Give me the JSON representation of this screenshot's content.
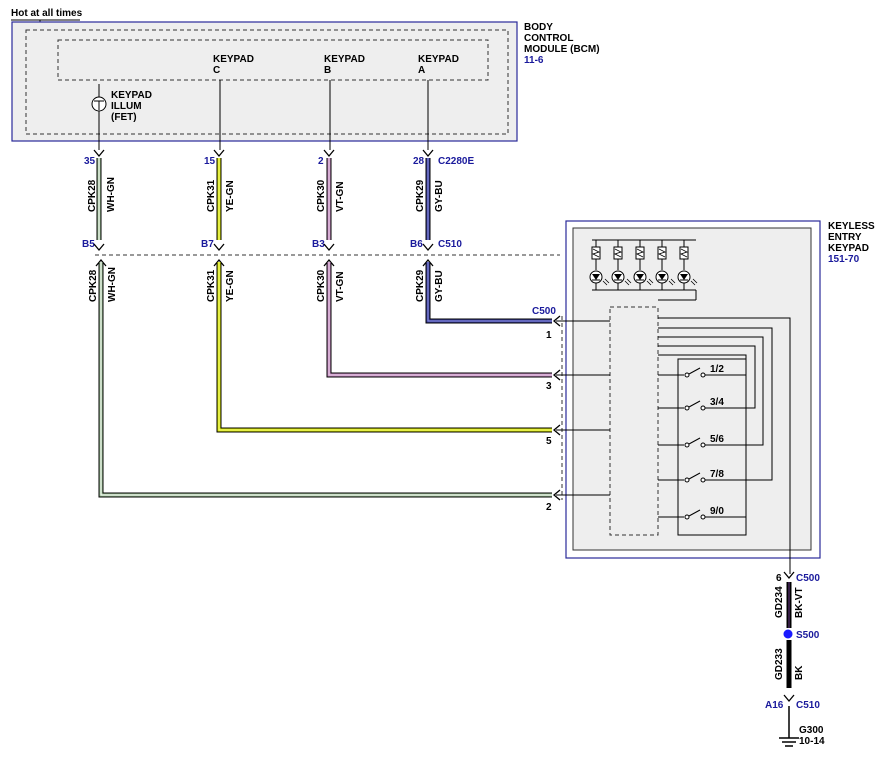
{
  "title_note": "Hot at all times",
  "bcm": {
    "name_line1": "BODY",
    "name_line2": "CONTROL",
    "name_line3": "MODULE (BCM)",
    "ref": "11-6",
    "illum_line1": "KEYPAD",
    "illum_line2": "ILLUM",
    "illum_line3": "(FET)",
    "kp_c_line1": "KEYPAD",
    "kp_c_line2": "C",
    "kp_b_line1": "KEYPAD",
    "kp_b_line2": "B",
    "kp_a_line1": "KEYPAD",
    "kp_a_line2": "A",
    "connector": "C2280E"
  },
  "wires": [
    {
      "circuit": "CPK28",
      "color_code": "WH-GN",
      "bcm_pin": "35",
      "c510_pin": "B5",
      "keypad_pin": "2",
      "hex": "#9bbf96"
    },
    {
      "circuit": "CPK31",
      "color_code": "YE-GN",
      "bcm_pin": "15",
      "c510_pin": "B7",
      "keypad_pin": "5",
      "hex": "#d4e000"
    },
    {
      "circuit": "CPK30",
      "color_code": "VT-GN",
      "bcm_pin": "2",
      "c510_pin": "B3",
      "keypad_pin": "3",
      "hex": "#c48ac0"
    },
    {
      "circuit": "CPK29",
      "color_code": "GY-BU",
      "bcm_pin": "28",
      "c510_pin": "B6",
      "keypad_pin": "1",
      "hex": "#3b3f9e"
    }
  ],
  "c510": {
    "name": "C510"
  },
  "keypad": {
    "name_line1": "KEYLESS",
    "name_line2": "ENTRY",
    "name_line3": "KEYPAD",
    "ref": "151-70",
    "connector": "C500",
    "buttons": [
      "1/2",
      "3/4",
      "5/6",
      "7/8",
      "9/0"
    ]
  },
  "ground": {
    "pin_c500": "6",
    "conn_c500": "C500",
    "wire1_circuit": "GD234",
    "wire1_color": "BK-VT",
    "splice": "S500",
    "wire2_circuit": "GD233",
    "wire2_color": "BK",
    "pin_c510": "A16",
    "conn_c510": "C510",
    "ground_name": "G300",
    "ground_ref": "10-14"
  }
}
